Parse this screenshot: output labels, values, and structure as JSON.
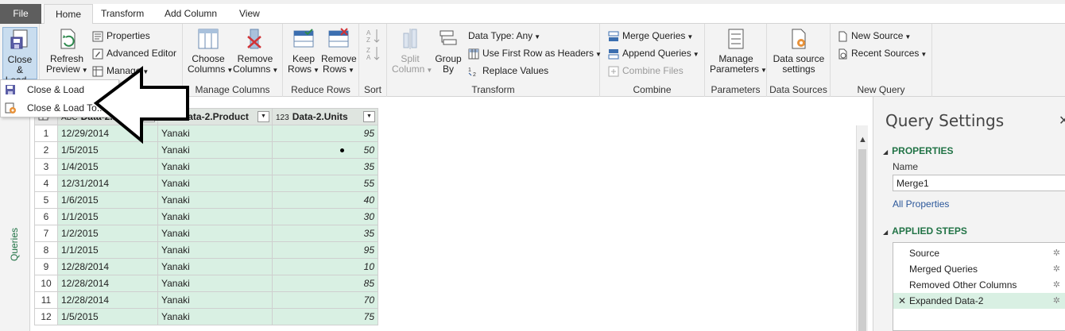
{
  "tabs": {
    "file": "File",
    "home": "Home",
    "transform": "Transform",
    "add_column": "Add Column",
    "view": "View"
  },
  "ribbon": {
    "close_group": {
      "close_load_line1": "Close &",
      "close_load_line2": "Load"
    },
    "query_group": {
      "refresh_line1": "Refresh",
      "refresh_line2": "Preview",
      "properties": "Properties",
      "advanced_editor": "Advanced Editor",
      "manage": "Manage"
    },
    "manage_columns": {
      "label": "Manage Columns",
      "choose_line1": "Choose",
      "choose_line2": "Columns",
      "remove_line1": "Remove",
      "remove_line2": "Columns"
    },
    "reduce_rows": {
      "label": "Reduce Rows",
      "keep_line1": "Keep",
      "keep_line2": "Rows",
      "remove_line1": "Remove",
      "remove_line2": "Rows"
    },
    "sort": {
      "label": "Sort"
    },
    "transform": {
      "label": "Transform",
      "split_line1": "Split",
      "split_line2": "Column",
      "group_line1": "Group",
      "group_line2": "By",
      "data_type": "Data Type: Any",
      "first_row": "Use First Row as Headers",
      "replace_values": "Replace Values"
    },
    "combine": {
      "label": "Combine",
      "merge": "Merge Queries",
      "append": "Append Queries",
      "combine_files": "Combine Files"
    },
    "parameters": {
      "label": "Parameters",
      "manage_line1": "Manage",
      "manage_line2": "Parameters"
    },
    "data_sources": {
      "label": "Data Sources",
      "settings_line1": "Data source",
      "settings_line2": "settings"
    },
    "new_query": {
      "label": "New Query",
      "new_source": "New Source",
      "recent_sources": "Recent Sources"
    }
  },
  "close_load_menu": {
    "item1": "Close & Load",
    "item2": "Close & Load To..."
  },
  "side_rail": {
    "label": "Queries"
  },
  "grid": {
    "columns": [
      {
        "type": "ABC",
        "name": "Data-2.Date"
      },
      {
        "type": "ABC",
        "name": "Data-2.Product"
      },
      {
        "type": "123",
        "name": "Data-2.Units"
      }
    ],
    "rows": [
      [
        "1",
        "12/29/2014",
        "Yanaki",
        "95"
      ],
      [
        "2",
        "1/5/2015",
        "Yanaki",
        "50"
      ],
      [
        "3",
        "1/4/2015",
        "Yanaki",
        "35"
      ],
      [
        "4",
        "12/31/2014",
        "Yanaki",
        "55"
      ],
      [
        "5",
        "1/6/2015",
        "Yanaki",
        "40"
      ],
      [
        "6",
        "1/1/2015",
        "Yanaki",
        "30"
      ],
      [
        "7",
        "1/2/2015",
        "Yanaki",
        "35"
      ],
      [
        "8",
        "1/1/2015",
        "Yanaki",
        "95"
      ],
      [
        "9",
        "12/28/2014",
        "Yanaki",
        "10"
      ],
      [
        "10",
        "12/28/2014",
        "Yanaki",
        "85"
      ],
      [
        "11",
        "12/28/2014",
        "Yanaki",
        "70"
      ],
      [
        "12",
        "1/5/2015",
        "Yanaki",
        "75"
      ]
    ]
  },
  "query_settings": {
    "title": "Query Settings",
    "properties_header": "PROPERTIES",
    "name_label": "Name",
    "name_value": "Merge1",
    "all_properties": "All Properties",
    "applied_steps_header": "APPLIED STEPS",
    "steps": [
      "Source",
      "Merged Queries",
      "Removed Other Columns",
      "Expanded Data-2"
    ]
  },
  "colors": {
    "accent_green": "#217346",
    "selected_fill": "#d9f0e3",
    "file_tab": "#5e5e5e"
  }
}
